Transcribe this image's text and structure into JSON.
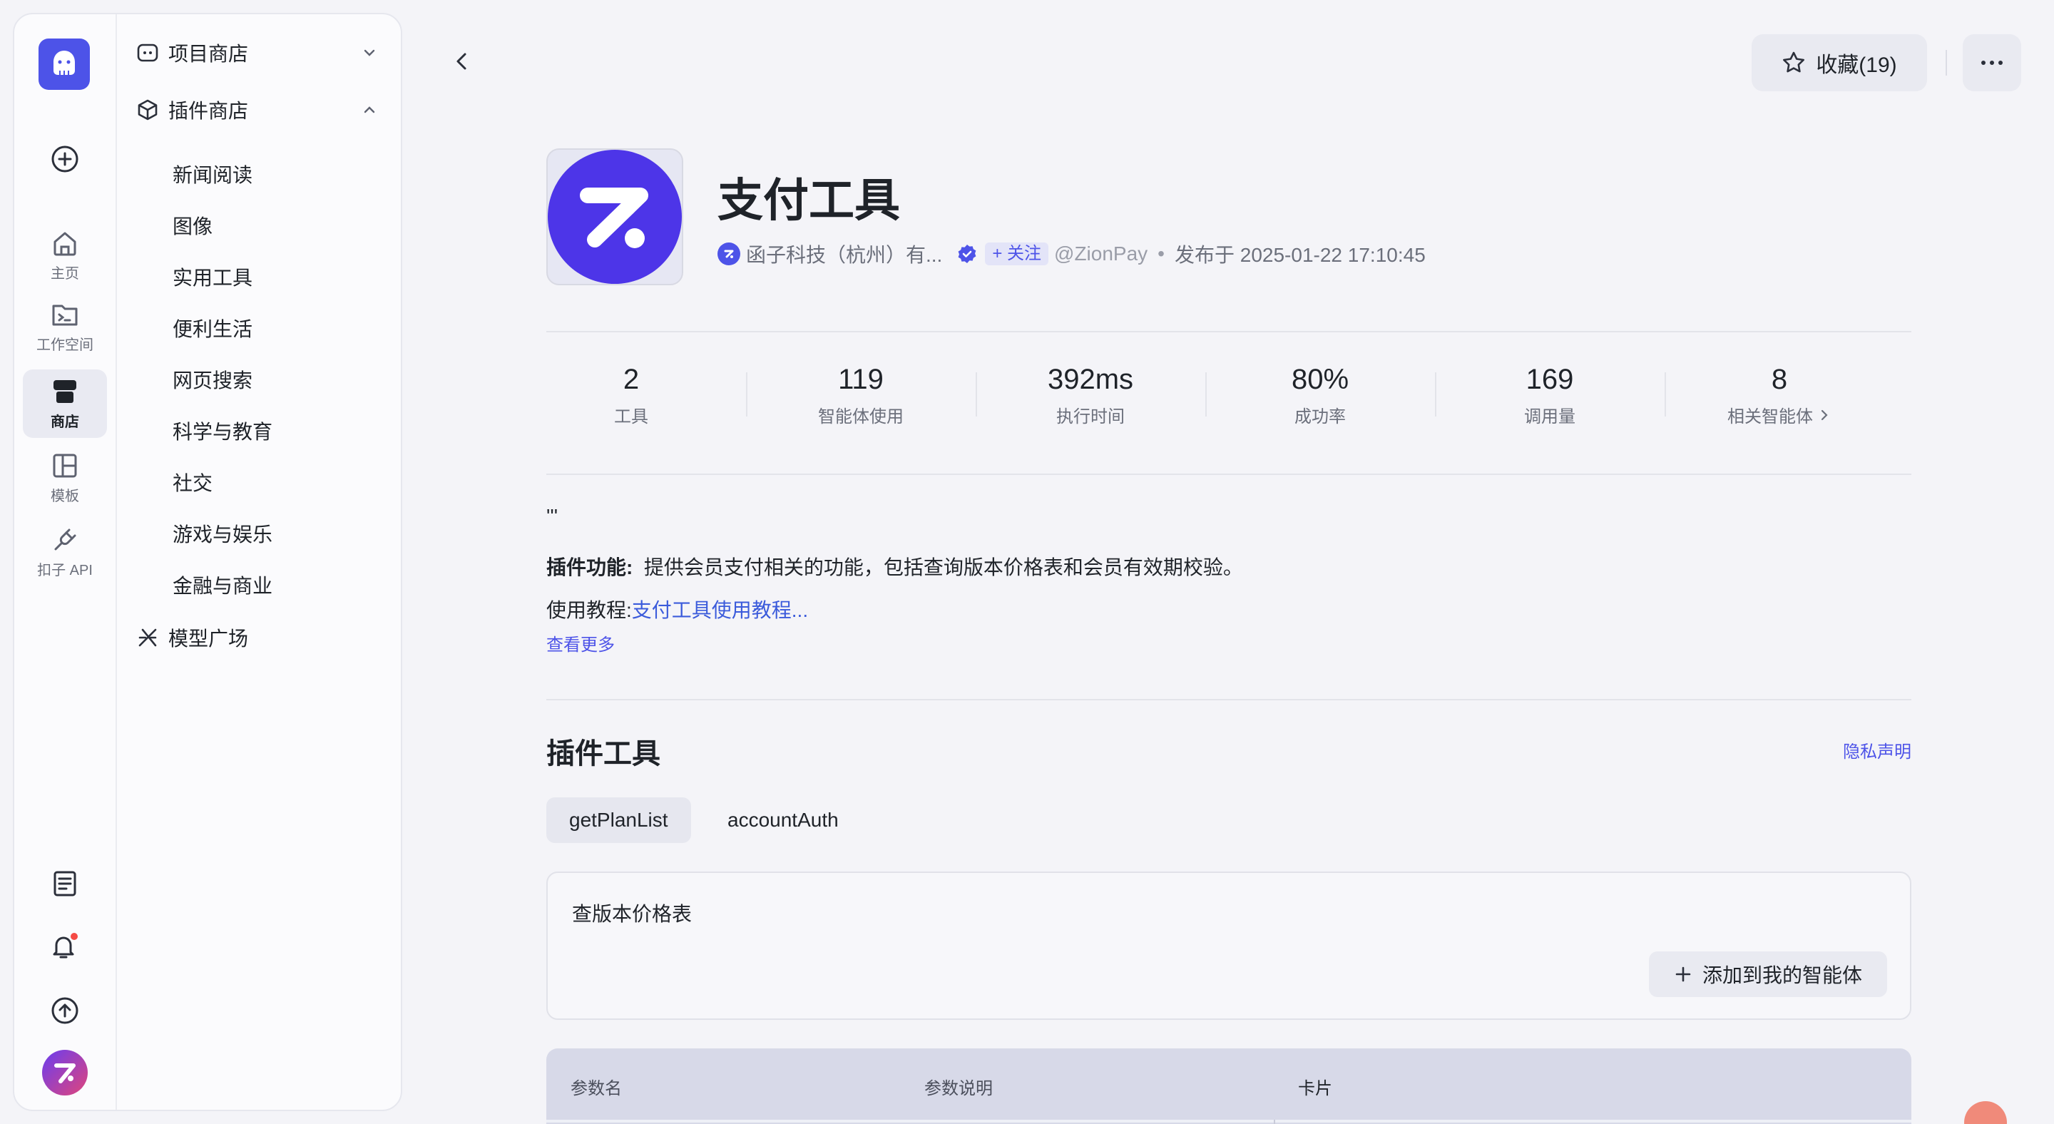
{
  "rail": {
    "items": [
      {
        "label": "主页",
        "icon": "home-icon"
      },
      {
        "label": "工作空间",
        "icon": "workspace-icon"
      },
      {
        "label": "商店",
        "icon": "store-icon"
      },
      {
        "label": "模板",
        "icon": "template-icon"
      },
      {
        "label": "扣子 API",
        "icon": "api-icon"
      }
    ]
  },
  "subnav": {
    "project_store": "项目商店",
    "plugin_store": "插件商店",
    "categories": [
      "新闻阅读",
      "图像",
      "实用工具",
      "便利生活",
      "网页搜索",
      "科学与教育",
      "社交",
      "游戏与娱乐",
      "金融与商业"
    ],
    "model_square": "模型广场"
  },
  "header": {
    "favorite_label": "收藏(19)",
    "more_label": "···"
  },
  "plugin": {
    "title": "支付工具",
    "publisher": "函子科技（杭州）有...",
    "follow_label": "+ 关注",
    "handle": "@ZionPay",
    "dot": "•",
    "published": "发布于 2025-01-22 17:10:45",
    "accent": "#4d53e8"
  },
  "stats": [
    {
      "value": "2",
      "label": "工具"
    },
    {
      "value": "119",
      "label": "智能体使用"
    },
    {
      "value": "392ms",
      "label": "执行时间"
    },
    {
      "value": "80%",
      "label": "成功率"
    },
    {
      "value": "169",
      "label": "调用量"
    },
    {
      "value": "8",
      "label": "相关智能体"
    }
  ],
  "description": {
    "quote": "'''",
    "feature_label": "插件功能:",
    "feature_text": "提供会员支付相关的功能，包括查询版本价格表和会员有效期校验。",
    "tutorial_label": "使用教程:",
    "tutorial_link": "支付工具使用教程...",
    "see_more": "查看更多"
  },
  "tools": {
    "section_title": "插件工具",
    "privacy": "隐私声明",
    "tabs": [
      "getPlanList",
      "accountAuth"
    ],
    "active_tab": "getPlanList",
    "card_desc": "查版本价格表",
    "add_label": "添加到我的智能体"
  },
  "params_table": {
    "headers": [
      "参数名",
      "参数说明",
      "卡片"
    ]
  }
}
